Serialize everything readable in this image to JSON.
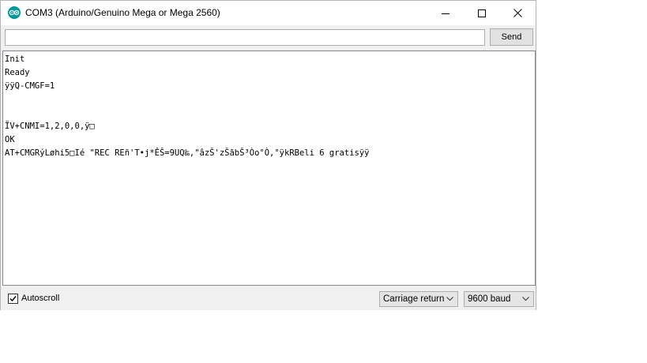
{
  "window": {
    "title": "COM3 (Arduino/Genuino Mega or Mega 2560)",
    "icon": "arduino-icon",
    "accent": "#00979c"
  },
  "input": {
    "value": "",
    "placeholder": ""
  },
  "toolbar": {
    "send_label": "Send"
  },
  "output": {
    "lines": [
      "Init",
      "Ready",
      "ÿÿQ-CMGF=1",
      "",
      "",
      "ÏV+CNMI=1,2,0,0,ÿ□",
      "OK",
      "AT+CMGRýLøhi5□Ié \"REC REñ'T•j*ÊŠ=9UQ‰,\"âzŠ'zŠãbŠ³Òo°Ò,°ÿkRBeli 6 gratisÿÿ"
    ]
  },
  "footer": {
    "autoscroll_label": "Autoscroll",
    "autoscroll_checked": true,
    "line_ending": "Carriage return",
    "baud_rate": "9600 baud"
  }
}
